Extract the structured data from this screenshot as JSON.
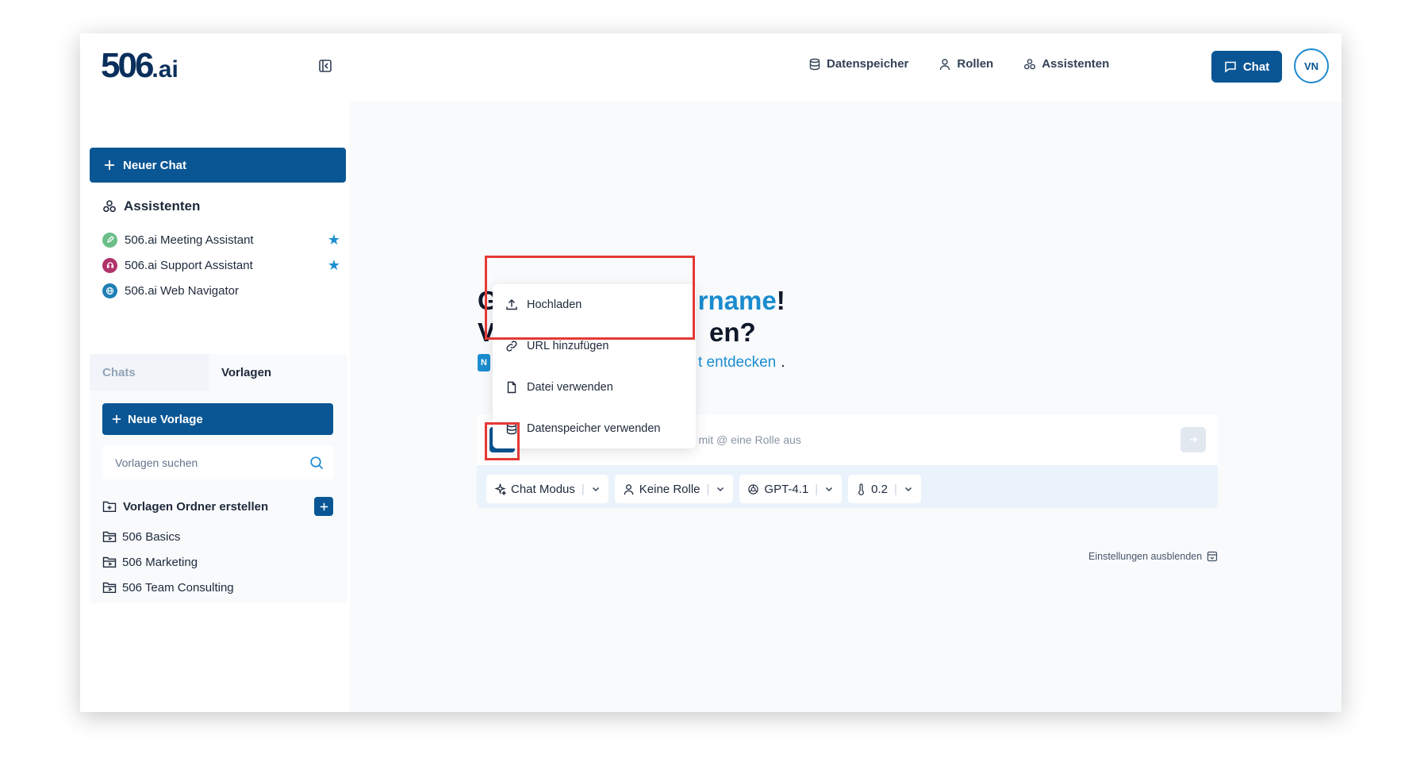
{
  "brand": {
    "logo_main": "506",
    "logo_suffix": ".ai"
  },
  "topnav": {
    "items": [
      {
        "label": "Datenspeicher",
        "icon": "database-icon"
      },
      {
        "label": "Rollen",
        "icon": "user-icon"
      },
      {
        "label": "Assistenten",
        "icon": "assistants-icon"
      }
    ],
    "chat_label": "Chat",
    "avatar_initials": "VN"
  },
  "sidebar": {
    "new_chat_label": "Neuer Chat",
    "assistants_title": "Assistenten",
    "assistants": [
      {
        "name": "506.ai Meeting Assistant",
        "color": "#6dbf8a",
        "starred": true
      },
      {
        "name": "506.ai Support Assistant",
        "color": "#b0336b",
        "starred": true
      },
      {
        "name": "506.ai Web Navigator",
        "color": "#1f7fb5",
        "starred": false
      }
    ],
    "tabs": {
      "chats": "Chats",
      "templates": "Vorlagen"
    },
    "new_template_label": "Neue Vorlage",
    "search_placeholder": "Vorlagen suchen",
    "create_folder_label": "Vorlagen Ordner erstellen",
    "folders": [
      "506 Basics",
      "506 Marketing",
      "506 Team Consulting"
    ]
  },
  "main": {
    "greeting_visible_start": "G",
    "greeting_highlight": "rname",
    "greeting_end": "!",
    "question_start": "V",
    "question_end": "en?",
    "badge_letter": "N",
    "discover_text": "t entdecken",
    "discover_end": ".",
    "prompt_placeholder": "Wählen Sie mit / eine Vorlage oder mit @ eine Rolle aus",
    "settings": {
      "mode": "Chat Modus",
      "role": "Keine Rolle",
      "model": "GPT-4.1",
      "temperature": "0.2"
    },
    "hide_settings_label": "Einstellungen ausblenden"
  },
  "dropdown": {
    "items": [
      {
        "label": "Hochladen",
        "icon": "upload-icon"
      },
      {
        "label": "URL hinzufügen",
        "icon": "link-icon"
      },
      {
        "label": "Datei verwenden",
        "icon": "file-icon"
      },
      {
        "label": "Datenspeicher verwenden",
        "icon": "database-icon"
      }
    ]
  },
  "colors": {
    "primary": "#0a5694",
    "accent": "#1a8ccf",
    "highlight": "#e53935",
    "star": "#1e8fcf"
  }
}
